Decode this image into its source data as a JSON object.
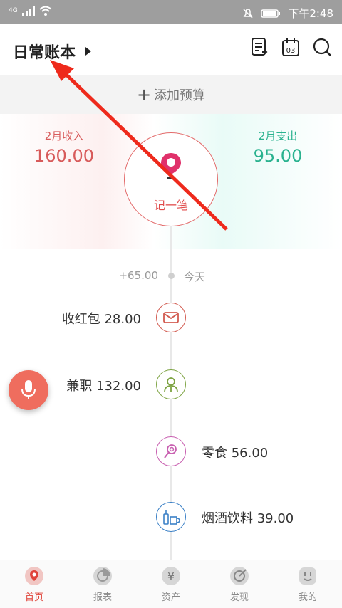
{
  "statusbar": {
    "network": "4G",
    "time": "下午2:48"
  },
  "header": {
    "book_title": "日常账本"
  },
  "budget": {
    "label": "添加预算"
  },
  "summary": {
    "income_label": "2月收入",
    "income_value": "160.00",
    "expense_label": "2月支出",
    "expense_value": "95.00",
    "record_label": "记一笔"
  },
  "today": {
    "amount": "+65.00",
    "label": "今天"
  },
  "records": [
    {
      "text": "收红包 28.00",
      "icon": "red-envelope-icon",
      "color": "#d25b50"
    },
    {
      "text": "兼职 132.00",
      "icon": "part-time-job-icon",
      "color": "#7da342"
    },
    {
      "text": "零食 56.00",
      "icon": "lollipop-icon",
      "color": "#c85fb0"
    },
    {
      "text": "烟酒饮料 39.00",
      "icon": "drinks-icon",
      "color": "#3b80c6"
    }
  ],
  "tabs": [
    {
      "label": "首页",
      "icon": "home-pin-icon"
    },
    {
      "label": "报表",
      "icon": "pie-chart-icon"
    },
    {
      "label": "资产",
      "icon": "yuan-icon"
    },
    {
      "label": "发现",
      "icon": "discover-icon"
    },
    {
      "label": "我的",
      "icon": "profile-icon"
    }
  ],
  "colors": {
    "accent": "#e0443a",
    "income": "#d85b5b",
    "expense": "#2ab28f"
  }
}
